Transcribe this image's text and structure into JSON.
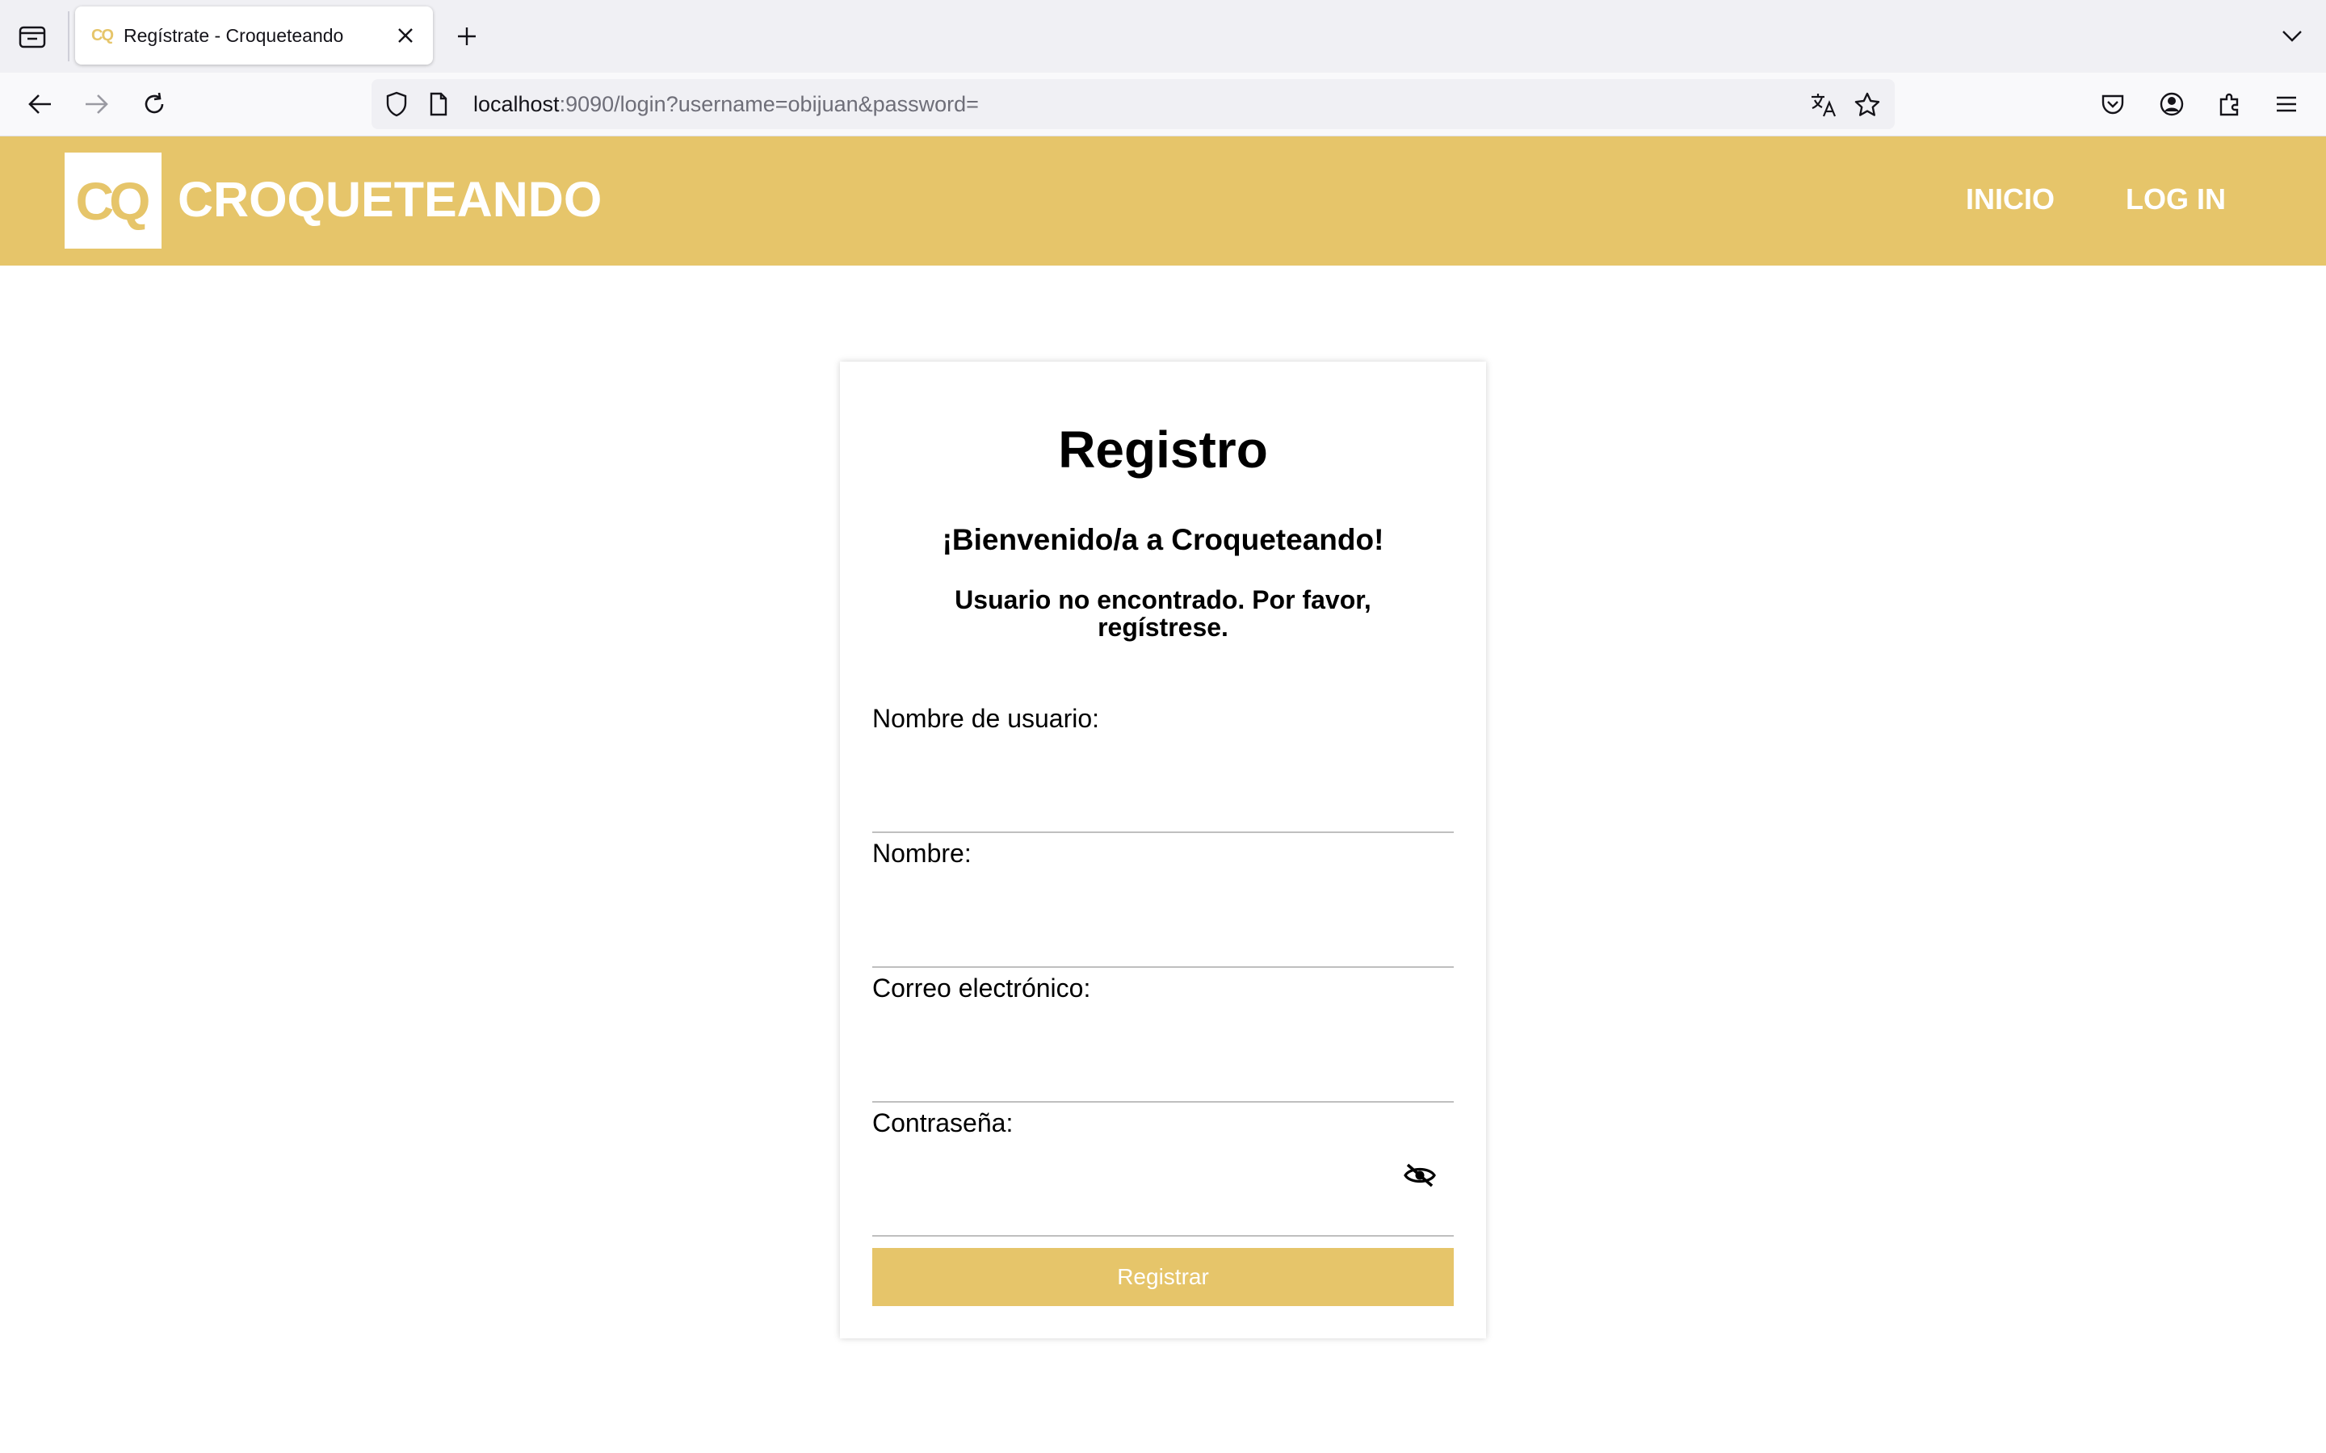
{
  "browser": {
    "tab": {
      "favicon_text": "CQ",
      "title": "Regístrate - Croqueteando"
    },
    "url": {
      "host": "localhost",
      "rest": ":9090/login?username=obijuan&password="
    },
    "icons": {
      "tab_list": "tab-list-icon",
      "close_tab": "close-icon",
      "new_tab": "plus-icon",
      "tab_overflow": "chevron-down-icon",
      "back": "arrow-left-icon",
      "forward": "arrow-right-icon",
      "reload": "reload-icon",
      "shield": "shield-icon",
      "page": "page-icon",
      "translate": "translate-icon",
      "bookmark": "star-icon",
      "pocket": "pocket-icon",
      "account": "account-icon",
      "extensions": "puzzle-icon",
      "menu": "hamburger-menu-icon"
    }
  },
  "site": {
    "logo_text": "CQ",
    "brand": "CROQUETEANDO",
    "nav": [
      "INICIO",
      "LOG IN"
    ],
    "accent_color": "#e6c56a"
  },
  "form": {
    "title": "Registro",
    "welcome": "¡Bienvenido/a a Croqueteando!",
    "message": "Usuario no encontrado. Por favor, regístrese.",
    "fields": [
      {
        "label": "Nombre de usuario:",
        "value": ""
      },
      {
        "label": "Nombre:",
        "value": ""
      },
      {
        "label": "Correo electrónico:",
        "value": ""
      },
      {
        "label": "Contraseña:",
        "value": ""
      }
    ],
    "password_toggle_icon": "eye-slash-icon",
    "submit_label": "Registrar"
  }
}
